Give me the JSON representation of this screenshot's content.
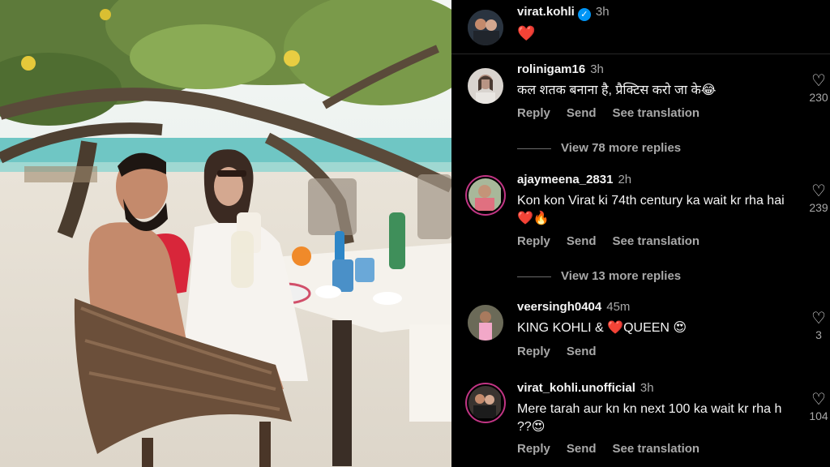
{
  "post": {
    "username": "virat.kohli",
    "time": "3h",
    "caption": "❤️"
  },
  "comments": [
    {
      "username": "rolinigam16",
      "time": "3h",
      "text": "कल शतक बनाना है, प्रैक्टिस करो जा के😂",
      "reply": "Reply",
      "send": "Send",
      "translate": "See translation",
      "likes": "230",
      "view_replies": "View 78 more replies"
    },
    {
      "username": "ajaymeena_2831",
      "time": "2h",
      "text": "Kon kon Virat ki 74th century ka wait kr rha hai ❤️🔥",
      "reply": "Reply",
      "send": "Send",
      "translate": "See translation",
      "likes": "239",
      "view_replies": "View 13 more replies"
    },
    {
      "username": "veersingh0404",
      "time": "45m",
      "text": "KING KOHLI & ❤️QUEEN 😍",
      "reply": "Reply",
      "send": "Send",
      "likes": "3"
    },
    {
      "username": "virat_kohli.unofficial",
      "time": "3h",
      "text": "Mere tarah aur kn kn next 100 ka wait kr rha h ??😍",
      "reply": "Reply",
      "send": "Send",
      "translate": "See translation",
      "likes": "104"
    }
  ],
  "icons": {
    "like": "heart-outline-icon",
    "verified": "verified-badge-icon"
  },
  "colors": {
    "background": "#000000",
    "text": "#f5f5f5",
    "muted": "#a8a8a8",
    "verified": "#0095f6",
    "story_ring": "#c13584"
  }
}
